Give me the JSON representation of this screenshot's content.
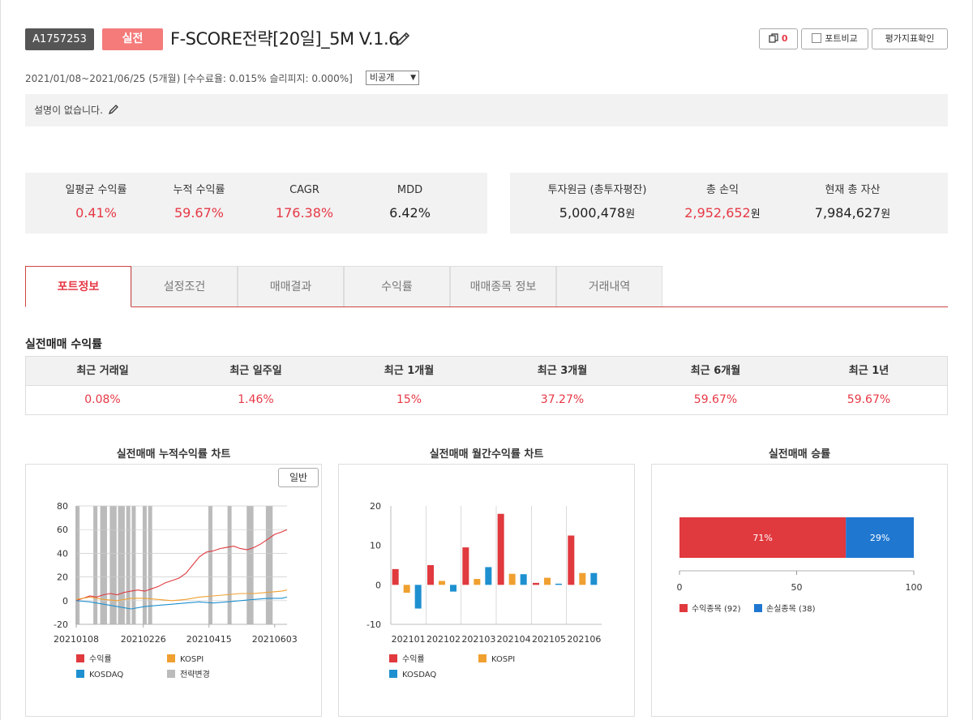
{
  "header": {
    "strategy_id": "A1757253",
    "mode": "실전",
    "title": "F-SCORE전략[20일]_5M V.1.6",
    "copy_count": "0",
    "compare_label": "포트비교",
    "eval_label": "평가지표확인",
    "meta": "2021/01/08~2021/06/25 (5개월) [수수료율: 0.015% 슬리피지: 0.000%]",
    "visibility": "비공개",
    "description": "설명이 없습니다."
  },
  "stats_left": [
    {
      "label": "일평균 수익률",
      "value": "0.41%"
    },
    {
      "label": "누적 수익률",
      "value": "59.67%"
    },
    {
      "label": "CAGR",
      "value": "176.38%"
    },
    {
      "label": "MDD",
      "value": "6.42%"
    }
  ],
  "stats_right": [
    {
      "label": "투자원금 (총투자평잔)",
      "value": "5,000,478",
      "unit": "원"
    },
    {
      "label": "총 손익",
      "value": "2,952,652",
      "unit": "원"
    },
    {
      "label": "현재 총 자산",
      "value": "7,984,627",
      "unit": "원"
    }
  ],
  "tabs": [
    "포트정보",
    "설정조건",
    "매매결과",
    "수익률",
    "매매종목 정보",
    "거래내역"
  ],
  "active_tab": 0,
  "section_title": "실전매매 수익률",
  "returns": {
    "headers": [
      "최근 거래일",
      "최근 일주일",
      "최근 1개월",
      "최근 3개월",
      "최근 6개월",
      "최근 1년"
    ],
    "values": [
      "0.08%",
      "1.46%",
      "15%",
      "37.27%",
      "59.67%",
      "59.67%"
    ]
  },
  "charts": {
    "cum_title": "실전매매 누적수익률 차트",
    "cum_mode": "일반",
    "monthly_title": "실전매매 월간수익률 차트",
    "winrate_title": "실전매매 승률"
  },
  "colors": {
    "accent": "#e63946",
    "return": "#e0393e",
    "kospi": "#f0a030",
    "kosdaq": "#1e90d0",
    "strategy_change": "#bbbbbb",
    "loss": "#1f77d0"
  },
  "chart_data": [
    {
      "type": "line",
      "title": "실전매매 누적수익률 차트",
      "x_ticks": [
        "20210108",
        "20210226",
        "20210415",
        "20210603"
      ],
      "ylim": [
        -20,
        80
      ],
      "y_ticks": [
        -20,
        0,
        20,
        40,
        60,
        80
      ],
      "grid": true,
      "legend": [
        "수익률",
        "KOSPI",
        "KOSDAQ",
        "전략변경"
      ],
      "series": [
        {
          "name": "수익률",
          "points": [
            [
              0,
              0
            ],
            [
              5,
              2
            ],
            [
              10,
              4
            ],
            [
              15,
              3
            ],
            [
              20,
              5
            ],
            [
              25,
              6
            ],
            [
              30,
              5
            ],
            [
              35,
              7
            ],
            [
              40,
              8
            ],
            [
              45,
              9
            ],
            [
              50,
              8
            ],
            [
              55,
              10
            ],
            [
              60,
              12
            ],
            [
              65,
              15
            ],
            [
              70,
              17
            ],
            [
              75,
              19
            ],
            [
              80,
              23
            ],
            [
              85,
              30
            ],
            [
              90,
              37
            ],
            [
              95,
              41
            ],
            [
              100,
              42
            ],
            [
              105,
              44
            ],
            [
              110,
              45
            ],
            [
              115,
              46
            ],
            [
              120,
              44
            ],
            [
              125,
              43
            ],
            [
              130,
              45
            ],
            [
              135,
              48
            ],
            [
              140,
              52
            ],
            [
              145,
              56
            ],
            [
              150,
              58
            ],
            [
              154,
              60
            ]
          ]
        },
        {
          "name": "KOSPI",
          "points": [
            [
              0,
              1
            ],
            [
              10,
              3
            ],
            [
              20,
              1
            ],
            [
              30,
              0
            ],
            [
              40,
              2
            ],
            [
              50,
              2
            ],
            [
              60,
              1
            ],
            [
              70,
              0
            ],
            [
              80,
              1
            ],
            [
              90,
              3
            ],
            [
              100,
              4
            ],
            [
              110,
              5
            ],
            [
              120,
              6
            ],
            [
              130,
              6
            ],
            [
              140,
              7
            ],
            [
              150,
              8
            ],
            [
              154,
              9
            ]
          ]
        },
        {
          "name": "KOSDAQ",
          "points": [
            [
              0,
              0
            ],
            [
              10,
              -1
            ],
            [
              20,
              -3
            ],
            [
              30,
              -5
            ],
            [
              40,
              -7
            ],
            [
              50,
              -5
            ],
            [
              60,
              -4
            ],
            [
              70,
              -3
            ],
            [
              80,
              -2
            ],
            [
              90,
              -1
            ],
            [
              100,
              -2
            ],
            [
              110,
              -1
            ],
            [
              120,
              0
            ],
            [
              130,
              1
            ],
            [
              140,
              2
            ],
            [
              150,
              2
            ],
            [
              154,
              3
            ]
          ]
        }
      ],
      "strategy_change_days": [
        1,
        14,
        19,
        21,
        26,
        28,
        32,
        34,
        38,
        42,
        50,
        54,
        98,
        112,
        126,
        128,
        140,
        142
      ]
    },
    {
      "type": "bar",
      "title": "실전매매 월간수익률 차트",
      "categories": [
        "202101",
        "202102",
        "202103",
        "202104",
        "202105",
        "202106"
      ],
      "ylim": [
        -10,
        20
      ],
      "y_ticks": [
        -10,
        0,
        10,
        20
      ],
      "series": [
        {
          "name": "수익률",
          "values": [
            4,
            5,
            9.5,
            18,
            0.5,
            12.5
          ]
        },
        {
          "name": "KOSPI",
          "values": [
            -2,
            1,
            1.5,
            2.8,
            1.8,
            3
          ]
        },
        {
          "name": "KOSDAQ",
          "values": [
            -6,
            -1.7,
            4.5,
            2.7,
            0.3,
            3
          ]
        }
      ]
    },
    {
      "type": "bar",
      "title": "실전매매 승률",
      "orientation": "horizontal-stacked",
      "xlim": [
        0,
        100
      ],
      "x_ticks": [
        0,
        50,
        100
      ],
      "series": [
        {
          "name": "수익종목 (92)",
          "value": 71,
          "label": "71%"
        },
        {
          "name": "손실종목 (38)",
          "value": 29,
          "label": "29%"
        }
      ]
    }
  ]
}
